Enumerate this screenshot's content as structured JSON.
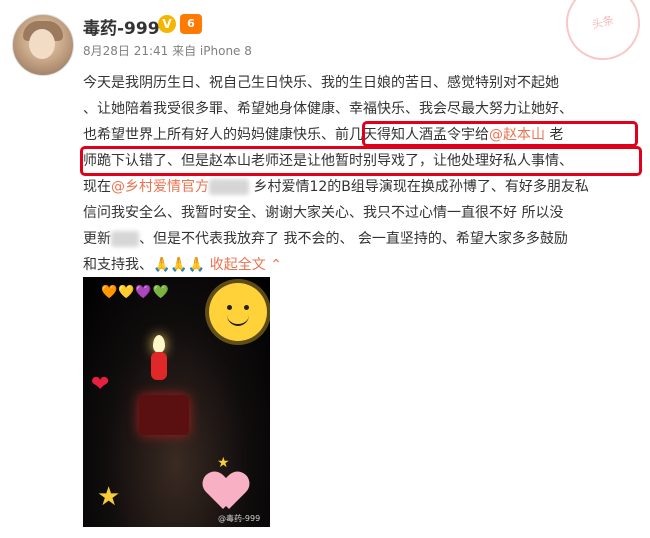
{
  "post": {
    "username": "毒药-999",
    "verified_badge": "V",
    "level_badge": "6",
    "meta": "8月28日 21:41 来自 iPhone 8",
    "stamp_text": "头条",
    "lines": [
      "今天是我阴历生日、祝自己生日快乐、我的生日娘的苦日、感觉特别对不起她",
      "、让她陪着我受很多罪、希望她身体健康、幸福快乐、我会尽最大努力让她好、",
      "也希望世界上所有好人的妈妈健康快乐、",
      "前几天得知人酒孟令宇给",
      "@赵本山",
      " 老",
      "师跪下认错了、但是赵本山老师还是让他暂时别导戏了，让他处理好私人事情、",
      "现在",
      "@乡村爱情官方",
      " 乡村爱情12的B组导演现在换成孙博了、有好多朋友私",
      "信问我安全么、我暂时安全、谢谢大家关心、我只不过心情一直很不好 所以没",
      "更新",
      "、但是不代表我放弃了 我不会的、 会一直坚持的、希望大家多多鼓励",
      "和支持我、",
      "🙏🙏🙏",
      " 收起全文 ",
      "⌃"
    ],
    "photo": {
      "icon_hearts": "🧡💛💜💚",
      "red_heart": "❤",
      "star": "★",
      "star_small": "★",
      "watermark": "@毒药-999"
    }
  }
}
